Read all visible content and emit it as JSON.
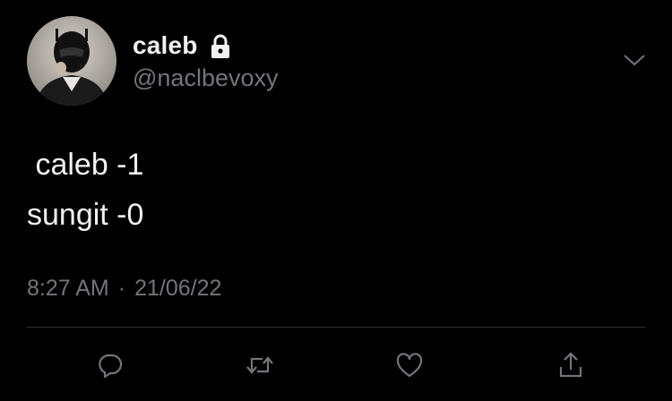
{
  "user": {
    "display_name": "caleb",
    "handle": "@naclbevoxy",
    "protected": true,
    "avatar_icon": "helmeted-person-avatar"
  },
  "tweet": {
    "lines": [
      " caleb -1",
      "sungit -0"
    ],
    "time": "8:27 AM",
    "separator": "·",
    "date": "21/06/22"
  },
  "actions": [
    {
      "name": "reply",
      "icon": "comment-bubble-icon"
    },
    {
      "name": "retweet",
      "icon": "retweet-icon"
    },
    {
      "name": "like",
      "icon": "heart-icon"
    },
    {
      "name": "share",
      "icon": "share-icon"
    }
  ],
  "colors": {
    "background": "#000000",
    "primary_text": "#f2f2f2",
    "secondary_text": "#71767b",
    "divider": "#2f3336"
  }
}
